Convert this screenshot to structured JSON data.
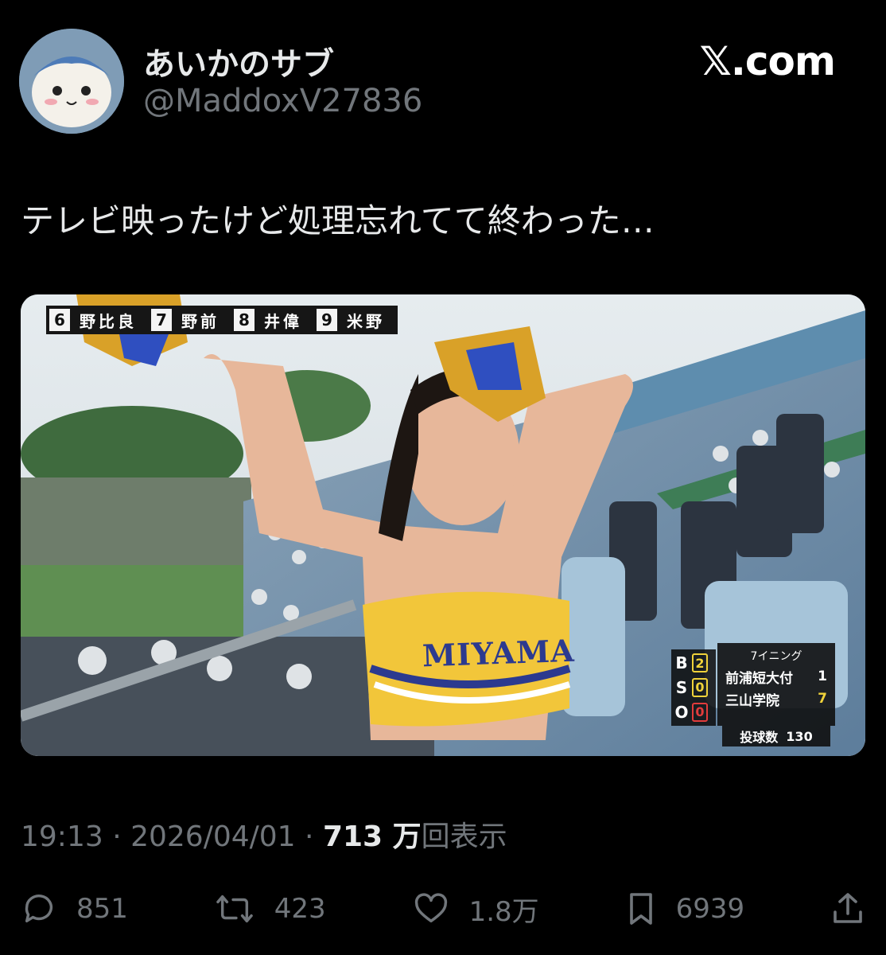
{
  "author": {
    "display_name": "あいかのサブ",
    "handle": "@MaddoxV27836"
  },
  "brand": "𝕏.com",
  "tweet": {
    "text": "テレビ映ったけど処理忘れてて終わった…"
  },
  "media": {
    "lineup": [
      {
        "num": "6",
        "name": "野比良"
      },
      {
        "num": "7",
        "name": "野前"
      },
      {
        "num": "8",
        "name": "井偉"
      },
      {
        "num": "9",
        "name": "米野"
      }
    ],
    "uniform_text": "MIYAMA",
    "scoreboard": {
      "bso": [
        {
          "label": "B",
          "count": "2"
        },
        {
          "label": "S",
          "count": "0"
        },
        {
          "label": "O",
          "count": "0"
        }
      ],
      "inning": "7イニング",
      "teams": [
        {
          "name": "前浦短大付",
          "score": "1"
        },
        {
          "name": "三山学院",
          "score": "7"
        }
      ],
      "pitch_label": "投球数",
      "pitch_count": "130"
    }
  },
  "meta": {
    "time": "19:13",
    "sep1": " · ",
    "date": "2026/04/01",
    "sep2": " · ",
    "views": "713 万",
    "views_label": "回表示"
  },
  "actions": {
    "replies": "851",
    "reposts": "423",
    "likes": "1.8万",
    "bookmarks": "6939"
  },
  "colors": {
    "background": "#000000",
    "primary_text": "#e7e9ea",
    "secondary_text": "#71767b"
  }
}
